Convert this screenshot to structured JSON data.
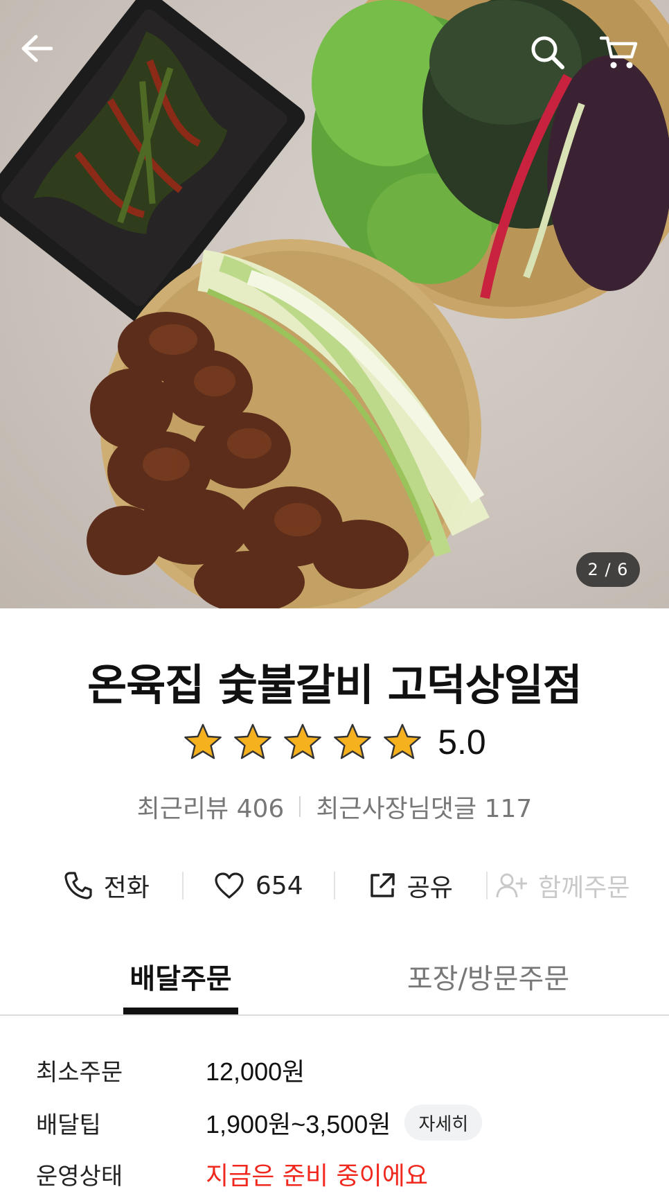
{
  "hero": {
    "image_counter": "2 / 6",
    "icons": {
      "back": "arrow-left-icon",
      "search": "search-icon",
      "cart": "cart-icon"
    }
  },
  "store": {
    "name": "온육집 숯불갈비 고덕상일점",
    "rating": "5.0",
    "star_count": 5,
    "star_color": "#f5b21e",
    "review_label": "최근리뷰 406",
    "owner_comment_label": "최근사장님댓글 117"
  },
  "actions": {
    "call": "전화",
    "like_count": "654",
    "share": "공유",
    "group_order": "함께주문"
  },
  "tabs": {
    "delivery": "배달주문",
    "pickup": "포장/방문주문"
  },
  "info": {
    "min_order_label": "최소주문",
    "min_order_value": "12,000원",
    "delivery_tip_label": "배달팁",
    "delivery_tip_value": "1,900원~3,500원",
    "detail_button": "자세히",
    "status_label": "운영상태",
    "status_value": "지금은 준비 중이에요",
    "status_color": "#f0281e"
  }
}
